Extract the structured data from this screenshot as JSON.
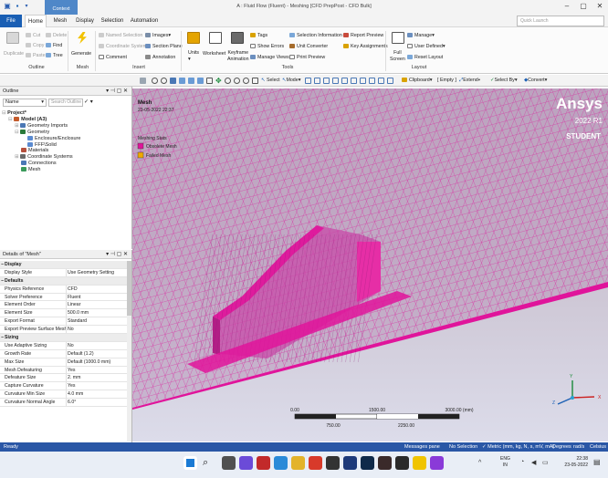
{
  "window": {
    "title": "A : Fluid Flow (Fluent) - Meshing [CFD PrepPost - CFD Bulk]",
    "context_tab": "Context"
  },
  "menu": {
    "file": "File",
    "tabs": [
      "Home",
      "Mesh",
      "Display",
      "Selection",
      "Automation"
    ],
    "quick_launch_placeholder": "Quick Launch"
  },
  "ribbon": {
    "duplicate": "Duplicate",
    "cut": "Cut",
    "copy": "Copy",
    "paste": "Paste",
    "delete": "Delete",
    "find": "Find",
    "tree": "Tree",
    "outline_group": "Outline",
    "generate": "Generate",
    "mesh_group": "Mesh",
    "named_selection": "Named Selection",
    "coordinate_system": "Coordinate System",
    "comment": "Comment",
    "images": "Images",
    "section_plane": "Section Plane",
    "annotation": "Annotation",
    "insert_group": "Insert",
    "units": "Units",
    "worksheet": "Worksheet",
    "keyframe": "Keyframe",
    "animation": "Animation",
    "tags": "Tags",
    "show_errors": "Show Errors",
    "manage_views": "Manage Views",
    "selection_information": "Selection Information",
    "unit_converter": "Unit Converter",
    "print_preview": "Print Preview",
    "report_preview": "Report Preview",
    "key_assignments": "Key Assignments",
    "tools_group": "Tools",
    "full": "Full",
    "screen": "Screen",
    "manage": "Manage",
    "user_defined": "User Defined",
    "reset_layout": "Reset Layout",
    "layout_group": "Layout"
  },
  "toolbar": {
    "select": "Select",
    "mode": "Mode",
    "clipboard": "Clipboard",
    "empty": "[ Empty ]",
    "extend": "Extend",
    "select_by": "Select By",
    "convert": "Convert"
  },
  "outline": {
    "title": "Outline",
    "filter_label": "Name",
    "search_placeholder": "Search Outline",
    "items": [
      "Project*",
      "Model (A3)",
      "Geometry Imports",
      "Geometry",
      "Enclosure/Enclosure",
      "FFF\\Solid",
      "Materials",
      "Coordinate Systems",
      "Connections",
      "Mesh"
    ]
  },
  "details": {
    "title": "Details of \"Mesh\"",
    "groups": [
      {
        "label": "Display",
        "rows": [
          [
            "Display Style",
            "Use Geometry Setting"
          ]
        ]
      },
      {
        "label": "Defaults",
        "rows": [
          [
            "Physics Reference",
            "CFD"
          ],
          [
            "Solver Preference",
            "Fluent"
          ],
          [
            "Element Order",
            "Linear"
          ],
          [
            "Element Size",
            "500.0 mm"
          ],
          [
            "Export Format",
            "Standard"
          ],
          [
            "Export Preview Surface Mesh",
            "No"
          ]
        ]
      },
      {
        "label": "Sizing",
        "rows": [
          [
            "Use Adaptive Sizing",
            "No"
          ],
          [
            "Growth Rate",
            "Default (1.2)"
          ],
          [
            "Max Size",
            "Default (1000.0 mm)"
          ],
          [
            "Mesh Defeaturing",
            "Yes"
          ],
          [
            "Defeature Size",
            "2. mm"
          ],
          [
            "Capture Curvature",
            "Yes"
          ],
          [
            "Curvature Min Size",
            "4.0 mm"
          ],
          [
            "Curvature Normal Angle",
            "6.0°"
          ]
        ]
      }
    ]
  },
  "viewport": {
    "label": "Mesh",
    "date": "23-05-2022 22:37",
    "legend_title": "Meshing Stats",
    "legend": [
      {
        "label": "Obsolete Mesh",
        "color": "#e0149b"
      },
      {
        "label": "Failed Mesh",
        "color": "#f0a800"
      }
    ],
    "brand": "Ansys",
    "version": "2022 R1",
    "edition": "STUDENT",
    "scale": {
      "top": [
        "0.00",
        "1500.00",
        "3000.00 (mm)"
      ],
      "bottom": [
        "750.00",
        "2250.00"
      ]
    },
    "axes": [
      "X",
      "Y",
      "Z"
    ]
  },
  "status": {
    "ready": "Ready",
    "messages": "Messages pane",
    "selection": "No Selection",
    "units": "Metric (mm, kg, N, s, mV, mA)",
    "degrees": "Degrees",
    "rads": "rad/s",
    "celsius": "Celsius"
  },
  "taskbar": {
    "lang": "ENG",
    "region": "IN",
    "time": "22:38",
    "date": "23-05-2022"
  },
  "colors": {
    "mesh": "#e0149b",
    "file_tab": "#1a5fb4",
    "status": "#2a57a6"
  }
}
